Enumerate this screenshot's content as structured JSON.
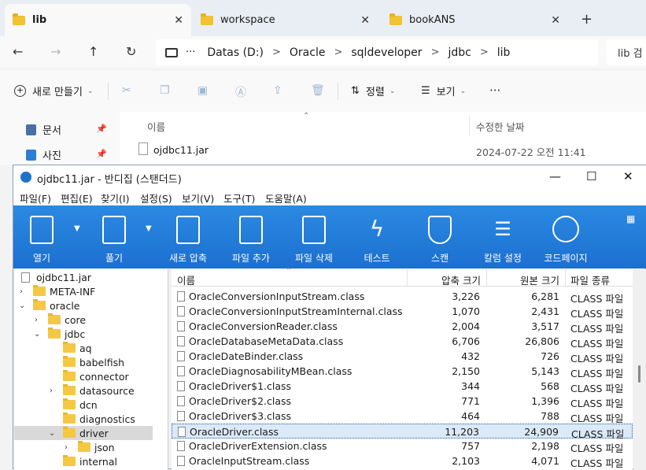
{
  "tabs": [
    {
      "label": "lib",
      "active": true
    },
    {
      "label": "workspace",
      "active": false
    },
    {
      "label": "bookANS",
      "active": false
    }
  ],
  "tab_close": "✕",
  "new_tab": "+",
  "nav": {
    "back": "←",
    "forward": "→",
    "up": "↑",
    "refresh": "↻",
    "more": "···",
    "search_placeholder": "lib 검"
  },
  "breadcrumb": [
    "Datas (D:)",
    "Oracle",
    "sqldeveloper",
    "jdbc",
    "lib"
  ],
  "breadcrumb_sep": ">",
  "toolbar": {
    "new_label": "새로 만들기",
    "sort_label": "정렬",
    "view_label": "보기",
    "more": "···"
  },
  "sidebar": [
    {
      "label": "문서",
      "color": "#4a6fa5"
    },
    {
      "label": "사진",
      "color": "#2b7ed6"
    }
  ],
  "explorer_columns": {
    "name": "이름",
    "modified": "수정한 날짜"
  },
  "explorer_file": {
    "name": "ojdbc11.jar",
    "modified": "2024-07-22 오전 11:41"
  },
  "bandizip": {
    "title": "ojdbc11.jar - 반디집 (스탠더드)",
    "window_buttons": {
      "minimize": "—",
      "maximize": "☐",
      "close": "✕"
    },
    "menu": [
      "파일(F)",
      "편집(E)",
      "찾기(I)",
      "설정(S)",
      "보기(V)",
      "도구(T)",
      "도움말(A)"
    ],
    "ribbon": [
      "열기",
      "풀기",
      "새로 압축",
      "파일 추가",
      "파일 삭제",
      "테스트",
      "스캔",
      "칼럼 설정",
      "코드페이지"
    ],
    "tree": [
      {
        "label": "ojdbc11.jar",
        "depth": 0,
        "expand": "",
        "type": "file"
      },
      {
        "label": "META-INF",
        "depth": 0,
        "expand": ">",
        "type": "folder"
      },
      {
        "label": "oracle",
        "depth": 0,
        "expand": "v",
        "type": "folder"
      },
      {
        "label": "core",
        "depth": 1,
        "expand": ">",
        "type": "folder"
      },
      {
        "label": "jdbc",
        "depth": 1,
        "expand": "v",
        "type": "folder"
      },
      {
        "label": "aq",
        "depth": 2,
        "expand": "",
        "type": "folder"
      },
      {
        "label": "babelfish",
        "depth": 2,
        "expand": "",
        "type": "folder"
      },
      {
        "label": "connector",
        "depth": 2,
        "expand": "",
        "type": "folder"
      },
      {
        "label": "datasource",
        "depth": 2,
        "expand": ">",
        "type": "folder"
      },
      {
        "label": "dcn",
        "depth": 2,
        "expand": "",
        "type": "folder"
      },
      {
        "label": "diagnostics",
        "depth": 2,
        "expand": "",
        "type": "folder"
      },
      {
        "label": "driver",
        "depth": 2,
        "expand": "v",
        "type": "folder",
        "selected": true
      },
      {
        "label": "json",
        "depth": 3,
        "expand": ">",
        "type": "folder"
      },
      {
        "label": "internal",
        "depth": 2,
        "expand": "",
        "type": "folder"
      }
    ],
    "columns": {
      "name": "이름",
      "compressed": "압축 크기",
      "original": "원본 크기",
      "type": "파일 종류"
    },
    "files": [
      {
        "name": "OracleConversionInputStream.class",
        "compressed": "3,226",
        "original": "6,281",
        "type": "CLASS 파일"
      },
      {
        "name": "OracleConversionInputStreamInternal.class",
        "compressed": "1,070",
        "original": "2,431",
        "type": "CLASS 파일"
      },
      {
        "name": "OracleConversionReader.class",
        "compressed": "2,004",
        "original": "3,517",
        "type": "CLASS 파일"
      },
      {
        "name": "OracleDatabaseMetaData.class",
        "compressed": "6,706",
        "original": "26,806",
        "type": "CLASS 파일"
      },
      {
        "name": "OracleDateBinder.class",
        "compressed": "432",
        "original": "726",
        "type": "CLASS 파일"
      },
      {
        "name": "OracleDiagnosabilityMBean.class",
        "compressed": "2,150",
        "original": "5,143",
        "type": "CLASS 파일"
      },
      {
        "name": "OracleDriver$1.class",
        "compressed": "344",
        "original": "568",
        "type": "CLASS 파일"
      },
      {
        "name": "OracleDriver$2.class",
        "compressed": "771",
        "original": "1,396",
        "type": "CLASS 파일"
      },
      {
        "name": "OracleDriver$3.class",
        "compressed": "464",
        "original": "788",
        "type": "CLASS 파일"
      },
      {
        "name": "OracleDriver.class",
        "compressed": "11,203",
        "original": "24,909",
        "type": "CLASS 파일",
        "selected": true
      },
      {
        "name": "OracleDriverExtension.class",
        "compressed": "757",
        "original": "2,198",
        "type": "CLASS 파일"
      },
      {
        "name": "OracleInputStream.class",
        "compressed": "2,103",
        "original": "4,071",
        "type": "CLASS 파일"
      }
    ]
  }
}
